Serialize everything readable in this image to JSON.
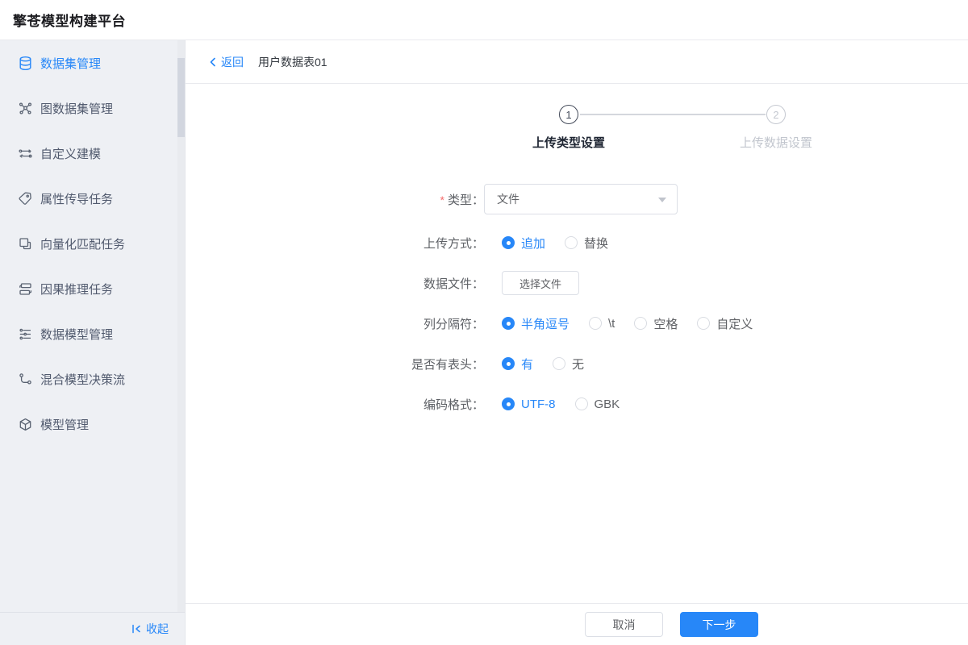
{
  "header": {
    "title": "擎苍模型构建平台"
  },
  "sidebar": {
    "items": [
      {
        "label": "数据集管理",
        "icon": "database-icon",
        "active": true
      },
      {
        "label": "图数据集管理",
        "icon": "graph-network-icon",
        "active": false
      },
      {
        "label": "自定义建模",
        "icon": "custom-flow-icon",
        "active": false
      },
      {
        "label": "属性传导任务",
        "icon": "tag-icon",
        "active": false
      },
      {
        "label": "向量化匹配任务",
        "icon": "copy-icon",
        "active": false
      },
      {
        "label": "因果推理任务",
        "icon": "stacked-blocks-icon",
        "active": false
      },
      {
        "label": "数据模型管理",
        "icon": "sliders-list-icon",
        "active": false
      },
      {
        "label": "混合模型决策流",
        "icon": "branch-icon",
        "active": false
      },
      {
        "label": "模型管理",
        "icon": "cube-icon",
        "active": false
      }
    ],
    "collapse_label": "收起",
    "collapse_icon": "collapse-left-icon"
  },
  "breadcrumb": {
    "back_label": "返回",
    "title": "用户数据表01"
  },
  "stepper": {
    "steps": [
      {
        "number": "1",
        "label": "上传类型设置",
        "active": true
      },
      {
        "number": "2",
        "label": "上传数据设置",
        "active": false
      }
    ]
  },
  "form": {
    "type": {
      "required_marker": "*",
      "label": "类型：",
      "value": "文件"
    },
    "upload_mode": {
      "label": "上传方式：",
      "options": [
        {
          "label": "追加",
          "selected": true
        },
        {
          "label": "替换",
          "selected": false
        }
      ]
    },
    "data_file": {
      "label": "数据文件：",
      "button_label": "选择文件"
    },
    "delimiter": {
      "label": "列分隔符：",
      "options": [
        {
          "label": "半角逗号",
          "selected": true
        },
        {
          "label": "\\t",
          "selected": false
        },
        {
          "label": "空格",
          "selected": false
        },
        {
          "label": "自定义",
          "selected": false
        }
      ]
    },
    "has_header": {
      "label": "是否有表头：",
      "options": [
        {
          "label": "有",
          "selected": true
        },
        {
          "label": "无",
          "selected": false
        }
      ]
    },
    "encoding": {
      "label": "编码格式：",
      "options": [
        {
          "label": "UTF-8",
          "selected": true
        },
        {
          "label": "GBK",
          "selected": false
        }
      ]
    }
  },
  "footer": {
    "cancel_label": "取消",
    "next_label": "下一步"
  },
  "colors": {
    "primary": "#2787f8",
    "sidebar_bg": "#eef0f4",
    "border": "#e9eaee",
    "step_active": "#444b5a",
    "step_inactive": "#c4c8d0",
    "required": "#f56c6c"
  }
}
